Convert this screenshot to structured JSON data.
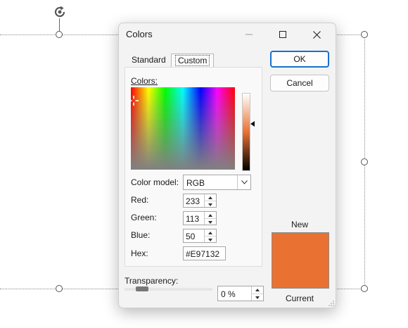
{
  "dialog": {
    "title": "Colors",
    "tabs": [
      {
        "label": "Standard",
        "active": false
      },
      {
        "label": "Custom",
        "active": true
      }
    ],
    "colors_label": "Colors:",
    "color_model": {
      "label": "Color model:",
      "value": "RGB"
    },
    "red": {
      "label": "Red:",
      "value": "233"
    },
    "green": {
      "label": "Green:",
      "value": "113"
    },
    "blue": {
      "label": "Blue:",
      "value": "50"
    },
    "hex": {
      "label": "Hex:",
      "value": "#E97132"
    },
    "transparency": {
      "label": "Transparency:",
      "value": "0 %",
      "level": 0
    },
    "buttons": {
      "ok": "OK",
      "cancel": "Cancel"
    },
    "preview": {
      "new_label": "New",
      "current_label": "Current",
      "new_color": "#E97132"
    }
  },
  "colors": {
    "selected": "#E97132",
    "accent": "#1A6FCE"
  },
  "icons": {
    "rotate": "rotate-handle-icon",
    "minimize": "minimize-icon",
    "maximize": "maximize-icon",
    "close": "close-icon"
  }
}
